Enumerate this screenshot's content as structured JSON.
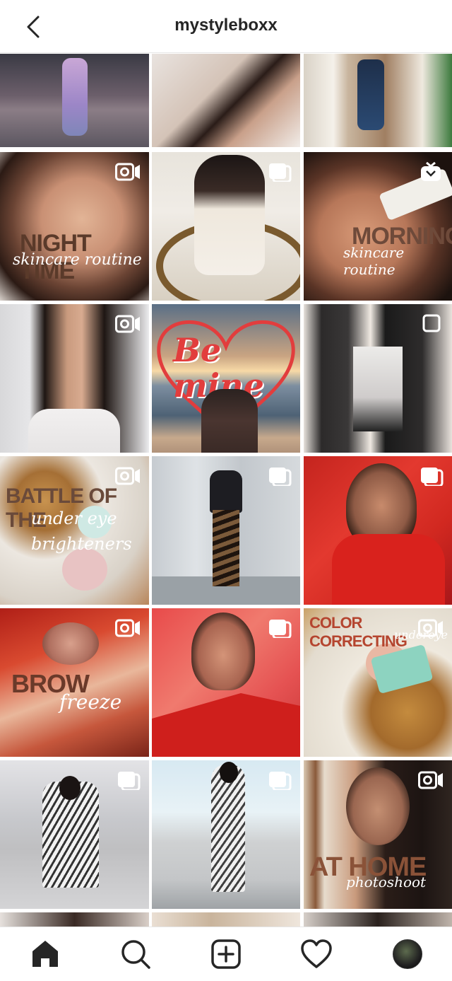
{
  "header": {
    "username": "mystyleboxx"
  },
  "grid": {
    "tiles": [
      {
        "type": "none"
      },
      {
        "type": "none"
      },
      {
        "type": "none"
      },
      {
        "type": "video",
        "overlay_main": "NIGHT TIME",
        "overlay_sub": "skincare routine"
      },
      {
        "type": "carousel"
      },
      {
        "type": "igtv",
        "overlay_main": "MORNING",
        "overlay_sub": "skincare routine"
      },
      {
        "type": "video"
      },
      {
        "type": "none",
        "overlay_main": "Be mine"
      },
      {
        "type": "single"
      },
      {
        "type": "video",
        "overlay_main": "BATTLE OF THE",
        "overlay_sub": "under eye brighteners"
      },
      {
        "type": "carousel"
      },
      {
        "type": "carousel"
      },
      {
        "type": "video",
        "overlay_main": "BROW",
        "overlay_sub": "freeze"
      },
      {
        "type": "carousel"
      },
      {
        "type": "video",
        "overlay_main": "COLOR CORRECTING",
        "overlay_sub": "undereye"
      },
      {
        "type": "carousel"
      },
      {
        "type": "carousel"
      },
      {
        "type": "video",
        "overlay_main": "AT HOME",
        "overlay_sub": "photoshoot"
      }
    ]
  },
  "tabbar": {
    "items": [
      "home-icon",
      "search-icon",
      "new-post-icon",
      "activity-heart-icon",
      "profile-avatar"
    ]
  }
}
